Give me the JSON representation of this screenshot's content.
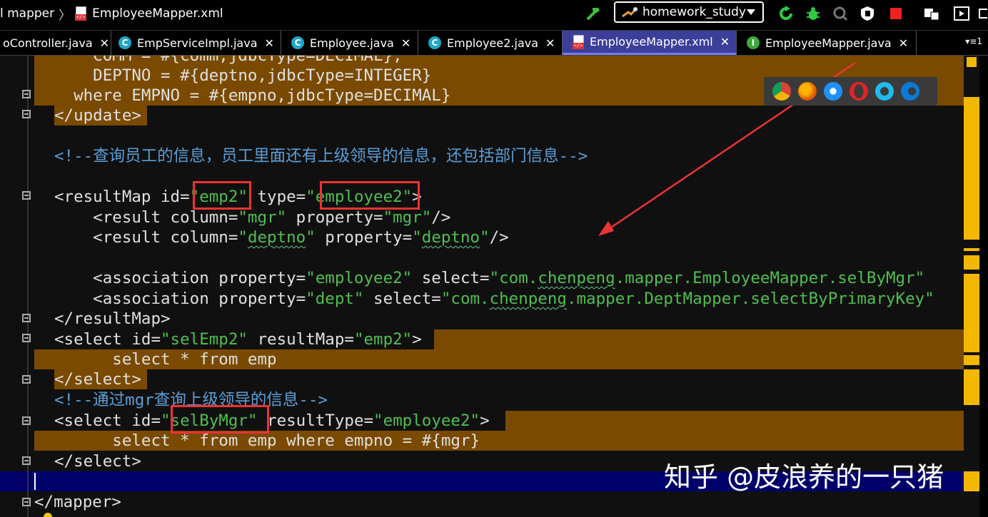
{
  "breadcrumb": {
    "items": [
      "l mapper",
      "EmployeeMapper.xml"
    ],
    "separator": "〉"
  },
  "run_config": {
    "label": "homework_study"
  },
  "tabs": [
    {
      "label": "oController.java",
      "icon": "",
      "close": "✕"
    },
    {
      "label": "EmpServiceImpl.java",
      "icon": "C",
      "close": "✕"
    },
    {
      "label": "Employee.java",
      "icon": "C",
      "close": "✕"
    },
    {
      "label": "Employee2.java",
      "icon": "C",
      "close": "✕"
    },
    {
      "label": "EmployeeMapper.xml",
      "icon": "xml",
      "close": "✕",
      "active": true
    },
    {
      "label": "EmployeeMapper.java",
      "icon": "I",
      "close": "✕"
    }
  ],
  "tab_list_label": "▾≡1",
  "code": {
    "l0": "    COMM = #{comm,jdbcType=DECIMAL},",
    "l1": "    DEPTNO = #{deptno,jdbcType=INTEGER}",
    "l2": "  where EMPNO = #{empno,jdbcType=DECIMAL}",
    "l3": "</update>",
    "l5_comment": "<!--查询员工的信息，员工里面还有上级领导的信息，还包括部门信息-->",
    "l7_open": "<resultMap id=",
    "l7_id": "\"emp2\"",
    "l7_type_attr": " type=",
    "l7_type": "\"employee2\"",
    "l7_close": ">",
    "l8_a": "    <result column=",
    "l8_b": "\"mgr\"",
    "l8_c": " property=",
    "l8_d": "\"mgr\"",
    "l8_e": "/>",
    "l9_a": "    <result column=",
    "l9_b1": "\"",
    "l9_b2": "deptno",
    "l9_b3": "\"",
    "l9_c": " property=",
    "l9_d1": "\"",
    "l9_d2": "deptno",
    "l9_d3": "\"",
    "l9_e": "/>",
    "l11_a": "    <association property=",
    "l11_b": "\"employee2\"",
    "l11_c": " select=",
    "l11_d1": "\"com.",
    "l11_d2": "chenpeng",
    "l11_d3": ".mapper.EmployeeMapper.selByMgr\"",
    "l12_a": "    <association property=",
    "l12_b": "\"dept\"",
    "l12_c": " select=",
    "l12_d1": "\"com.",
    "l12_d2": "chenpeng",
    "l12_d3": ".mapper.DeptMapper.selectByPrimaryKey\"",
    "l13": "</resultMap>",
    "l14_a": "<select id=",
    "l14_b": "\"selEmp2\"",
    "l14_c": " resultMap=",
    "l14_d": "\"emp2\"",
    "l14_e": ">",
    "l15": "      select * from emp",
    "l16": "</select>",
    "l17_comment": "<!--通过mgr查询上级领导的信息-->",
    "l18_a": "<select id=",
    "l18_b": "\"selByMgr\"",
    "l18_c": " resultType=",
    "l18_d": "\"employee2\"",
    "l18_e": ">",
    "l19": "      select * from emp where empno = #{mgr}",
    "l20": "</select>",
    "l22": "</mapper>"
  },
  "watermark": "知乎 @皮浪养的一只猪",
  "colors": {
    "highlight": "#7a4a00",
    "string": "#4fbf4f",
    "comment": "#5a9fd8",
    "active_tab": "#3c3f9a",
    "annotation": "#e33333"
  },
  "browser_icons": [
    "chrome-icon",
    "firefox-icon",
    "safari-icon",
    "opera-icon",
    "ie-icon",
    "edge-icon"
  ]
}
